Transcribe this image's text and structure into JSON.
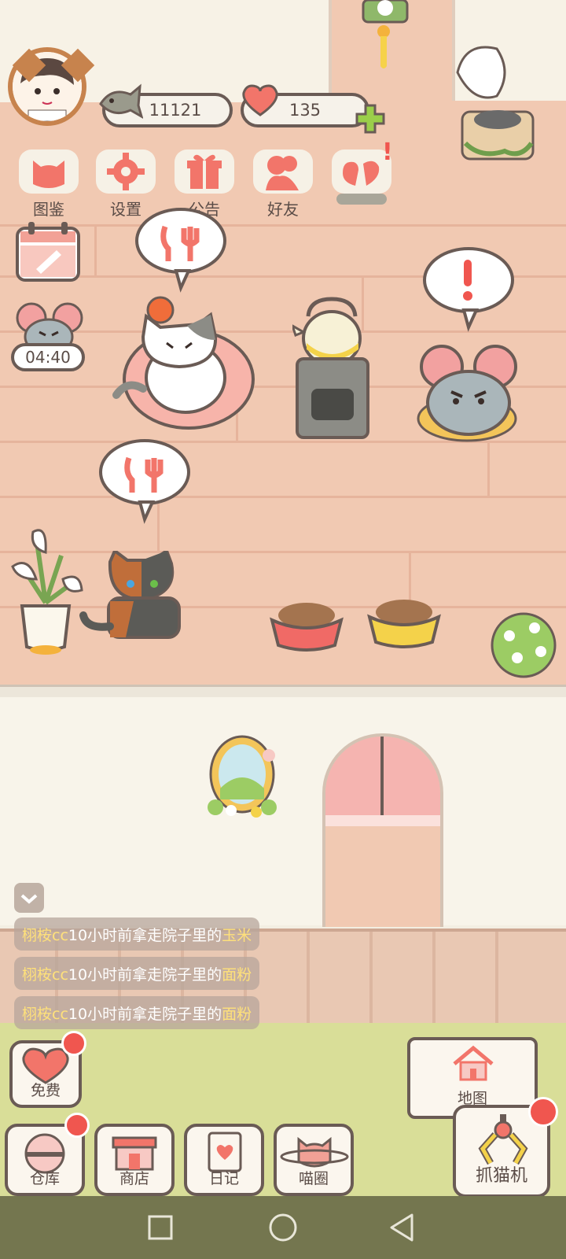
{
  "currency": {
    "fish": "11121",
    "hearts": "135"
  },
  "menu": [
    {
      "label": "图鉴",
      "icon": "cat-head-icon"
    },
    {
      "label": "设置",
      "icon": "gear-icon"
    },
    {
      "label": "公告",
      "icon": "gift-icon"
    },
    {
      "label": "好友",
      "icon": "friends-icon"
    },
    {
      "label": "",
      "icon": "heart-hands-icon",
      "badge": "!"
    }
  ],
  "timer": "04:40",
  "feed": [
    {
      "prefix": "栩桉cc",
      "middle": "10小时前拿走院子里的",
      "item": "玉米"
    },
    {
      "prefix": "栩桉cc",
      "middle": "10小时前拿走院子里的",
      "item": "面粉"
    },
    {
      "prefix": "栩桉cc",
      "middle": "10小时前拿走院子里的",
      "item": "面粉"
    }
  ],
  "bottom": {
    "free": "免费",
    "warehouse": "仓库",
    "shop": "商店",
    "diary": "日记",
    "circle": "喵圈",
    "map": "地图",
    "claw": "抓猫机"
  },
  "colors": {
    "accent": "#f07a6a",
    "badge": "#f0564f",
    "outline": "#6a5b55",
    "highlight": "#ffe17a"
  }
}
